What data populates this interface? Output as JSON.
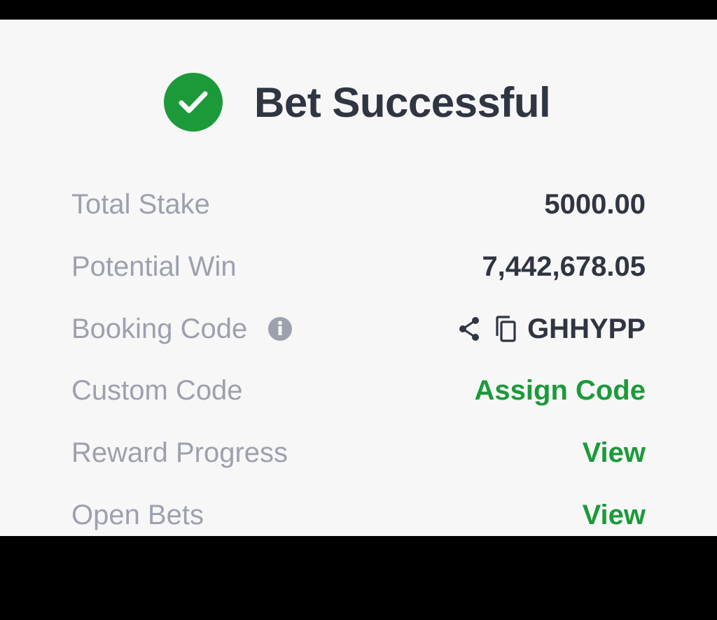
{
  "header": {
    "title": "Bet Successful",
    "icon": "check-circle-icon",
    "accent_color": "#1c9a3a"
  },
  "rows": [
    {
      "label": "Total Stake",
      "value": "5000.00"
    },
    {
      "label": "Potential Win",
      "value": "7,442,678.05"
    },
    {
      "label": "Booking Code",
      "value": "GHHYPP",
      "icons": [
        "info-icon",
        "share-icon",
        "copy-icon"
      ]
    },
    {
      "label": "Custom Code",
      "value": "Assign Code"
    },
    {
      "label": "Reward Progress",
      "value": "View"
    },
    {
      "label": "Open Bets",
      "value": "View"
    }
  ],
  "colors": {
    "label": "#9da1ad",
    "value": "#2f3541",
    "link": "#1c9a3a",
    "background": "#f7f7f8"
  }
}
